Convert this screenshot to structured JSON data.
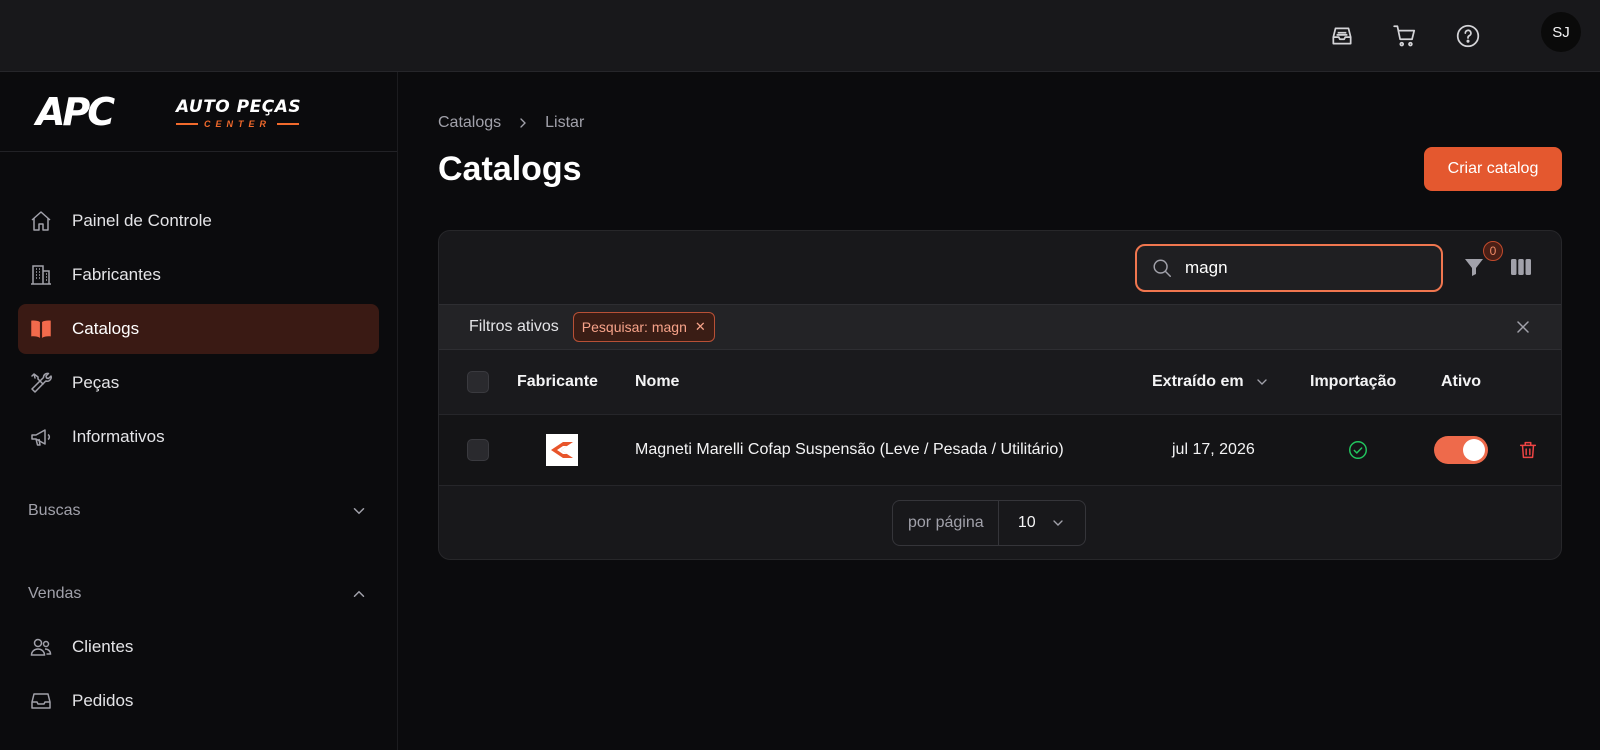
{
  "header": {
    "user_initials": "SJ"
  },
  "brand": {
    "logo_main": "APC",
    "logo_line1": "AUTO PEÇAS",
    "logo_line2": "CENTER"
  },
  "sidebar": {
    "items": [
      {
        "label": "Painel de Controle",
        "icon": "home-icon"
      },
      {
        "label": "Fabricantes",
        "icon": "building-icon"
      },
      {
        "label": "Catalogs",
        "icon": "book-open-icon",
        "active": true
      },
      {
        "label": "Peças",
        "icon": "wrench-screwdriver-icon"
      },
      {
        "label": "Informativos",
        "icon": "megaphone-icon"
      }
    ],
    "group_buscas": "Buscas",
    "group_vendas": "Vendas",
    "vendas_items": [
      {
        "label": "Clientes",
        "icon": "users-icon"
      },
      {
        "label": "Pedidos",
        "icon": "inbox-icon"
      }
    ]
  },
  "breadcrumb": {
    "root": "Catalogs",
    "current": "Listar"
  },
  "page": {
    "title": "Catalogs",
    "create_label": "Criar catalog"
  },
  "table_tools": {
    "search_value": "magn",
    "filter_count": "0"
  },
  "active_filters": {
    "label": "Filtros ativos",
    "chip": "Pesquisar: magn"
  },
  "table": {
    "headers": {
      "maker": "Fabricante",
      "name": "Nome",
      "extracted": "Extraído em",
      "import": "Importação",
      "active": "Ativo"
    },
    "rows": [
      {
        "name": "Magneti Marelli Cofap Suspensão (Leve / Pesada / Utilitário)",
        "extracted": "jul 17, 2026",
        "import_ok": true,
        "active": true
      }
    ]
  },
  "pagination": {
    "per_page_label": "por página",
    "per_page_value": "10"
  },
  "colors": {
    "accent": "#e4582f",
    "success": "#22c55e",
    "danger": "#ef4444"
  }
}
